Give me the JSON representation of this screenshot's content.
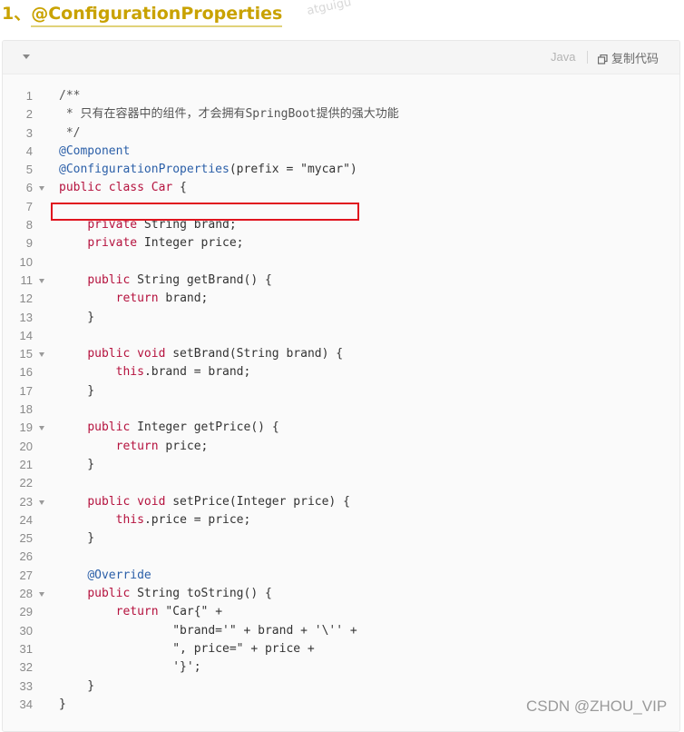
{
  "heading": {
    "number": "1、",
    "title": "@ConfigurationProperties"
  },
  "watermark": "atguigu",
  "toolbar": {
    "language": "Java",
    "copy_label": "复制代码"
  },
  "code_lines": [
    {
      "n": "1",
      "fold": false,
      "tokens": [
        {
          "t": "/**",
          "c": "cm"
        }
      ]
    },
    {
      "n": "2",
      "fold": false,
      "tokens": [
        {
          "t": " * 只有在容器中的组件，才会拥有SpringBoot提供的强大功能",
          "c": "cm"
        }
      ]
    },
    {
      "n": "3",
      "fold": false,
      "tokens": [
        {
          "t": " */",
          "c": "cm"
        }
      ]
    },
    {
      "n": "4",
      "fold": false,
      "tokens": [
        {
          "t": "@Component",
          "c": "an"
        }
      ]
    },
    {
      "n": "5",
      "fold": false,
      "tokens": [
        {
          "t": "@ConfigurationProperties",
          "c": "an"
        },
        {
          "t": "(prefix = ",
          "c": ""
        },
        {
          "t": "\"mycar\"",
          "c": "str"
        },
        {
          "t": ")",
          "c": ""
        }
      ]
    },
    {
      "n": "6",
      "fold": true,
      "tokens": [
        {
          "t": "public class",
          "c": "kw"
        },
        {
          "t": " ",
          "c": ""
        },
        {
          "t": "Car",
          "c": "kw"
        },
        {
          "t": " {",
          "c": ""
        }
      ]
    },
    {
      "n": "7",
      "fold": false,
      "tokens": []
    },
    {
      "n": "8",
      "fold": false,
      "tokens": [
        {
          "t": "    ",
          "c": ""
        },
        {
          "t": "private",
          "c": "kw"
        },
        {
          "t": " String brand;",
          "c": ""
        }
      ]
    },
    {
      "n": "9",
      "fold": false,
      "tokens": [
        {
          "t": "    ",
          "c": ""
        },
        {
          "t": "private",
          "c": "kw"
        },
        {
          "t": " Integer price;",
          "c": ""
        }
      ]
    },
    {
      "n": "10",
      "fold": false,
      "tokens": []
    },
    {
      "n": "11",
      "fold": true,
      "tokens": [
        {
          "t": "    ",
          "c": ""
        },
        {
          "t": "public",
          "c": "kw"
        },
        {
          "t": " String getBrand() {",
          "c": ""
        }
      ]
    },
    {
      "n": "12",
      "fold": false,
      "tokens": [
        {
          "t": "        ",
          "c": ""
        },
        {
          "t": "return",
          "c": "kw"
        },
        {
          "t": " brand;",
          "c": ""
        }
      ]
    },
    {
      "n": "13",
      "fold": false,
      "tokens": [
        {
          "t": "    }",
          "c": ""
        }
      ]
    },
    {
      "n": "14",
      "fold": false,
      "tokens": []
    },
    {
      "n": "15",
      "fold": true,
      "tokens": [
        {
          "t": "    ",
          "c": ""
        },
        {
          "t": "public void",
          "c": "kw"
        },
        {
          "t": " setBrand(String brand) {",
          "c": ""
        }
      ]
    },
    {
      "n": "16",
      "fold": false,
      "tokens": [
        {
          "t": "        ",
          "c": ""
        },
        {
          "t": "this",
          "c": "kw"
        },
        {
          "t": ".brand = brand;",
          "c": ""
        }
      ]
    },
    {
      "n": "17",
      "fold": false,
      "tokens": [
        {
          "t": "    }",
          "c": ""
        }
      ]
    },
    {
      "n": "18",
      "fold": false,
      "tokens": []
    },
    {
      "n": "19",
      "fold": true,
      "tokens": [
        {
          "t": "    ",
          "c": ""
        },
        {
          "t": "public",
          "c": "kw"
        },
        {
          "t": " Integer getPrice() {",
          "c": ""
        }
      ]
    },
    {
      "n": "20",
      "fold": false,
      "tokens": [
        {
          "t": "        ",
          "c": ""
        },
        {
          "t": "return",
          "c": "kw"
        },
        {
          "t": " price;",
          "c": ""
        }
      ]
    },
    {
      "n": "21",
      "fold": false,
      "tokens": [
        {
          "t": "    }",
          "c": ""
        }
      ]
    },
    {
      "n": "22",
      "fold": false,
      "tokens": []
    },
    {
      "n": "23",
      "fold": true,
      "tokens": [
        {
          "t": "    ",
          "c": ""
        },
        {
          "t": "public void",
          "c": "kw"
        },
        {
          "t": " setPrice(Integer price) {",
          "c": ""
        }
      ]
    },
    {
      "n": "24",
      "fold": false,
      "tokens": [
        {
          "t": "        ",
          "c": ""
        },
        {
          "t": "this",
          "c": "kw"
        },
        {
          "t": ".price = price;",
          "c": ""
        }
      ]
    },
    {
      "n": "25",
      "fold": false,
      "tokens": [
        {
          "t": "    }",
          "c": ""
        }
      ]
    },
    {
      "n": "26",
      "fold": false,
      "tokens": []
    },
    {
      "n": "27",
      "fold": false,
      "tokens": [
        {
          "t": "    ",
          "c": ""
        },
        {
          "t": "@Override",
          "c": "an"
        }
      ]
    },
    {
      "n": "28",
      "fold": true,
      "tokens": [
        {
          "t": "    ",
          "c": ""
        },
        {
          "t": "public",
          "c": "kw"
        },
        {
          "t": " String toString() {",
          "c": ""
        }
      ]
    },
    {
      "n": "29",
      "fold": false,
      "tokens": [
        {
          "t": "        ",
          "c": ""
        },
        {
          "t": "return",
          "c": "kw"
        },
        {
          "t": " \"Car{\" +",
          "c": ""
        }
      ]
    },
    {
      "n": "30",
      "fold": false,
      "tokens": [
        {
          "t": "                \"brand='\" + brand + '\\'' +",
          "c": ""
        }
      ]
    },
    {
      "n": "31",
      "fold": false,
      "tokens": [
        {
          "t": "                \", price=\" + price +",
          "c": ""
        }
      ]
    },
    {
      "n": "32",
      "fold": false,
      "tokens": [
        {
          "t": "                '}';",
          "c": ""
        }
      ]
    },
    {
      "n": "33",
      "fold": false,
      "tokens": [
        {
          "t": "    }",
          "c": ""
        }
      ]
    },
    {
      "n": "34",
      "fold": false,
      "tokens": [
        {
          "t": "}",
          "c": ""
        }
      ]
    }
  ],
  "credit": "CSDN @ZHOU_VIP",
  "colors": {
    "keyword": "#b5123e",
    "annotation": "#2b5fa8",
    "highlight_border": "#e0141e",
    "heading": "#c9a200"
  }
}
